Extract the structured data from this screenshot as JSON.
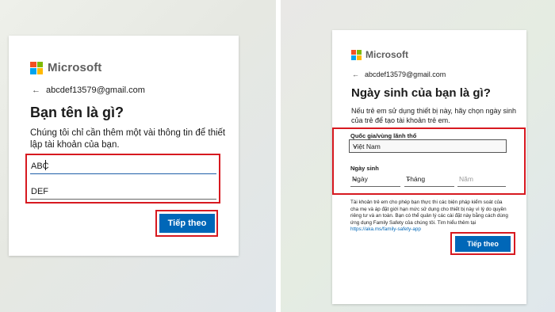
{
  "brand": {
    "name": "Microsoft",
    "colors": {
      "red": "#f25022",
      "green": "#7fba00",
      "blue": "#00a4ef",
      "yellow": "#ffb900"
    }
  },
  "accent_color": "#0067b8",
  "highlight_color": "#d71920",
  "left_panel": {
    "back_icon": "arrow-left-icon",
    "email": "abcdef13579@gmail.com",
    "heading": "Bạn tên là gì?",
    "description": "Chúng tôi chỉ cần thêm một vài thông tin để thiết lập tài khoản của bạn.",
    "first_name_value": "ABC",
    "last_name_value": "DEF",
    "next_button": "Tiếp theo"
  },
  "right_panel": {
    "back_icon": "arrow-left-icon",
    "email": "abcdef13579@gmail.com",
    "heading": "Ngày sinh của bạn là gì?",
    "description": "Nếu trẻ em sử dụng thiết bị này, hãy chọn ngày sinh của trẻ để tạo tài khoản trẻ em.",
    "country_label": "Quốc gia/vùng lãnh thổ",
    "country_value": "Việt Nam",
    "dob_label": "Ngày sinh",
    "day_value": "Ngày",
    "month_value": "Tháng",
    "year_placeholder": "Năm",
    "info_text": "Tài khoản trẻ em cho phép bạn thực thi các biện pháp kiểm soát của cha mẹ và áp đặt giới hạn mức sử dụng cho thiết bị này vì lý do quyền riêng tư và an toàn. Bạn có thể quản lý các cài đặt này bằng cách dùng ứng dụng Family Safety của chúng tôi. Tìm hiểu thêm tại",
    "info_link": "https://aka.ms/family-safety-app",
    "next_button": "Tiếp theo",
    "chevron_icon": "chevron-down-icon"
  }
}
